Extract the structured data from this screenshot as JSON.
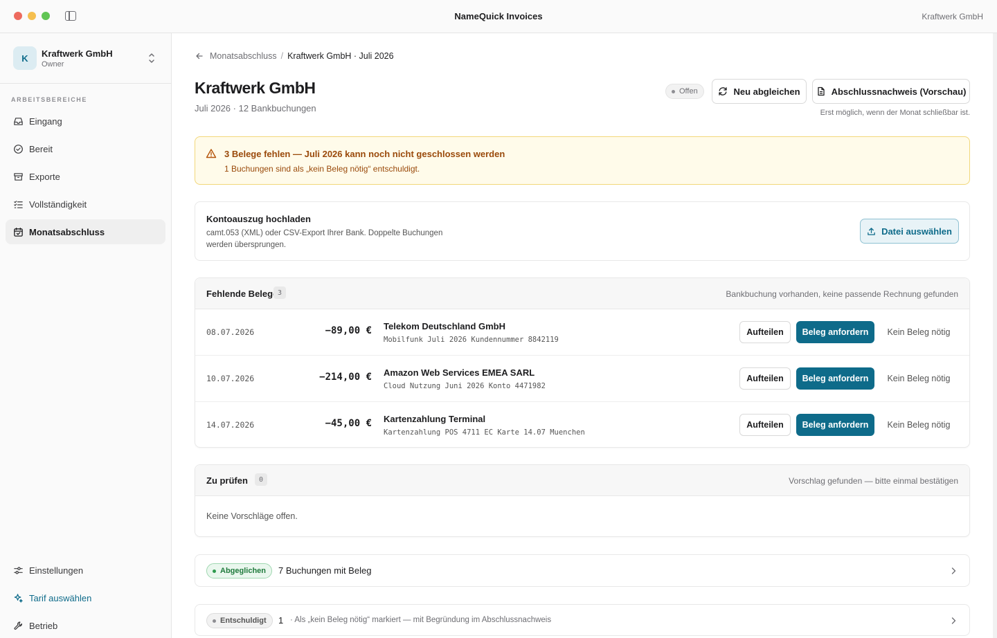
{
  "window": {
    "title": "NameQuick Invoices",
    "right_label": "Kraftwerk GmbH"
  },
  "sidebar": {
    "org_initial": "K",
    "org_name": "Kraftwerk GmbH",
    "org_role": "Owner",
    "section_label": "ARBEITSBEREICHE",
    "items": [
      {
        "label": "Eingang",
        "icon": "inbox-icon"
      },
      {
        "label": "Bereit",
        "icon": "check-circle-icon"
      },
      {
        "label": "Exporte",
        "icon": "archive-icon"
      },
      {
        "label": "Vollständigkeit",
        "icon": "checklist-icon"
      },
      {
        "label": "Monatsabschluss",
        "icon": "calendar-check-icon",
        "active": true
      }
    ],
    "footer": [
      {
        "label": "Einstellungen",
        "icon": "sliders-icon"
      },
      {
        "label": "Tarif auswählen",
        "icon": "sparkle-icon"
      },
      {
        "label": "Betrieb",
        "icon": "wrench-icon"
      }
    ]
  },
  "breadcrumb": {
    "parent": "Monatsabschluss",
    "separator": "/",
    "current": "Kraftwerk GmbH · Juli 2026"
  },
  "header": {
    "title": "Kraftwerk GmbH",
    "subtitle": "Juli 2026 · 12 Bankbuchungen",
    "status": "Offen",
    "reconcile_label": "Neu abgleichen",
    "report_label": "Abschlussnachweis (Vorschau)",
    "report_hint": "Erst möglich, wenn der Monat schließbar ist."
  },
  "alert": {
    "title": "3 Belege fehlen — Juli 2026 kann noch nicht geschlossen werden",
    "body": "1 Buchungen sind als „kein Beleg nötig“ entschuldigt."
  },
  "upload": {
    "title": "Kontoauszug hochladen",
    "description": "camt.053 (XML) oder CSV-Export Ihrer Bank. Doppelte Buchungen werden übersprungen.",
    "button": "Datei auswählen"
  },
  "missing": {
    "title": "Fehlende Belege",
    "count": "3",
    "note": "Bankbuchung vorhanden, keine passende Rechnung gefunden",
    "split_label": "Aufteilen",
    "request_label": "Beleg anfordern",
    "none_label": "Kein Beleg nötig",
    "rows": [
      {
        "date": "08.07.2026",
        "amount": "−89,00 €",
        "vendor": "Telekom Deutschland GmbH",
        "memo": "Mobilfunk Juli 2026 Kundennummer 8842119"
      },
      {
        "date": "10.07.2026",
        "amount": "−214,00 €",
        "vendor": "Amazon Web Services EMEA SARL",
        "memo": "Cloud Nutzung Juni 2026 Konto 4471982"
      },
      {
        "date": "14.07.2026",
        "amount": "−45,00 €",
        "vendor": "Kartenzahlung Terminal",
        "memo": "Kartenzahlung POS 4711 EC Karte 14.07 Muenchen"
      }
    ]
  },
  "review": {
    "title": "Zu prüfen",
    "count": "0",
    "note": "Vorschlag gefunden — bitte einmal bestätigen",
    "empty": "Keine Vorschläge offen."
  },
  "matched": {
    "pill": "Abgeglichen",
    "label": "7 Buchungen mit Beleg"
  },
  "excused": {
    "pill": "Entschuldigt",
    "count": "1",
    "label": "· Als „kein Beleg nötig“ markiert — mit Begründung im Abschlussnachweis"
  },
  "colors": {
    "accent": "#0e6b8a",
    "warning_text": "#9a4a0b",
    "warning_bg": "#fffbea",
    "success": "#1e7a3b"
  }
}
